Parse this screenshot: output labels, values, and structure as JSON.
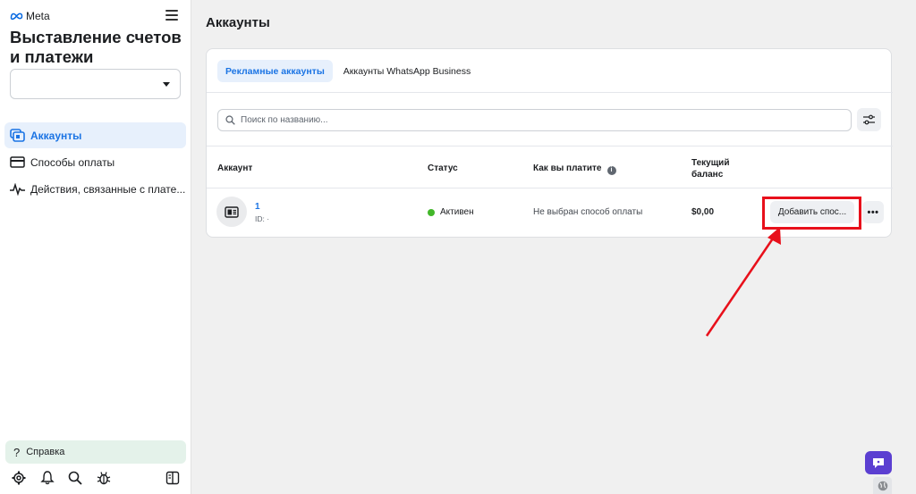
{
  "sidebar": {
    "brand": "Meta",
    "title": "Выставление счетов и платежи",
    "account_select_value": "",
    "nav": [
      {
        "label": "Аккаунты",
        "icon": "accounts-icon",
        "active": true
      },
      {
        "label": "Способы оплаты",
        "icon": "credit-card-icon",
        "active": false
      },
      {
        "label": "Действия, связанные с плате...",
        "icon": "activity-icon",
        "active": false
      }
    ],
    "help_label": "Справка",
    "bottom_icons": [
      "settings-icon",
      "bell-icon",
      "search-icon",
      "bug-icon",
      "panel-toggle-icon"
    ]
  },
  "main": {
    "page_title": "Аккаунты",
    "tabs": [
      {
        "label": "Рекламные аккаунты",
        "active": true
      },
      {
        "label": "Аккаунты WhatsApp Business",
        "active": false
      }
    ],
    "search": {
      "placeholder": "Поиск по названию...",
      "value": ""
    },
    "table": {
      "headers": {
        "account": "Аккаунт",
        "status": "Статус",
        "method": "Как вы платите",
        "balance": "Текущий баланс"
      },
      "rows": [
        {
          "name": "1",
          "id": "ID: ·",
          "status": "Активен",
          "status_color": "#42b72a",
          "method": "Не выбран способ оплаты",
          "balance": "$0,00",
          "action": "Добавить спос..."
        }
      ]
    }
  },
  "colors": {
    "accent": "#1b74e4",
    "highlight": "#e8101b",
    "chat": "#5b3fd1"
  }
}
